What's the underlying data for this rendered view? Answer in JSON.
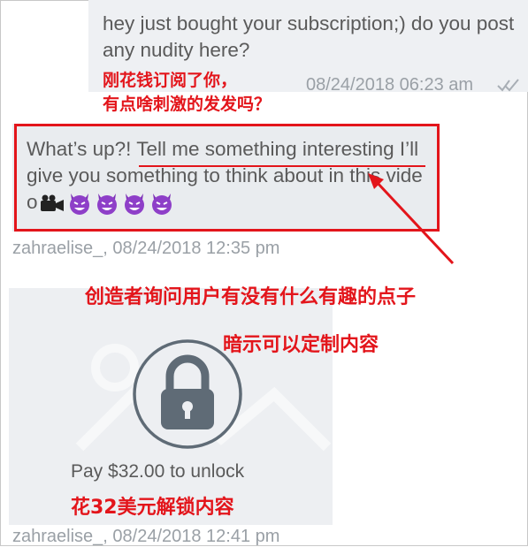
{
  "messages": {
    "outgoing": {
      "text": "hey just bought your subscription;) do you post any nudity here?",
      "meta": "08/24/2018 06:23 am"
    },
    "incoming": {
      "text_before": "What’s up?!",
      "text_highlight": " Tell me something interestin",
      "text_after": "g I’ll give you something to think about in this video",
      "meta": "zahraelise_, 08/24/2018 12:35 pm"
    },
    "locked_media": {
      "unlock_label": "Pay $32.00 to unlock",
      "meta": "zahraelise_, 08/24/2018 12:41 pm"
    }
  },
  "annotations": {
    "anno1_line1": "刚花钱订阅了你，",
    "anno1_line2": "有点啥刺激的发发吗？",
    "anno2": "创造者询问用户有没有什么有趣的点子",
    "anno3": "暗示可以定制内容",
    "anno4": "花32美元解锁内容"
  },
  "colors": {
    "annotation_red": "#e3151b",
    "bubble_bg": "#e9ecef",
    "text_gray": "#5a5a5a",
    "meta_gray": "#9aa0a6"
  },
  "icons": [
    "double-check-icon",
    "video-camera-emoji",
    "smiling-devil-emoji",
    "lock-icon"
  ]
}
